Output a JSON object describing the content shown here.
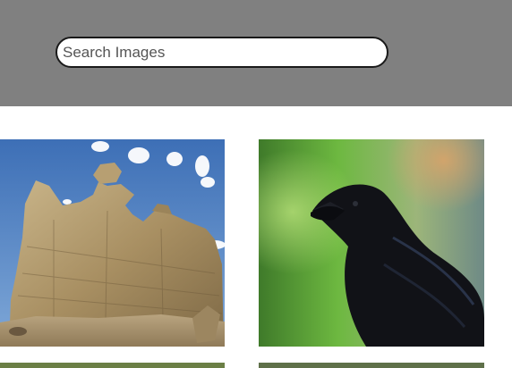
{
  "header": {
    "background": "#808080"
  },
  "search": {
    "placeholder": "Search Images",
    "value": ""
  },
  "gallery": {
    "images": [
      {
        "subject": "sandstone-rock-formation",
        "alt": ""
      },
      {
        "subject": "black-crow",
        "alt": ""
      },
      {
        "subject": "partial-image",
        "alt": ""
      },
      {
        "subject": "partial-image",
        "alt": ""
      }
    ]
  }
}
